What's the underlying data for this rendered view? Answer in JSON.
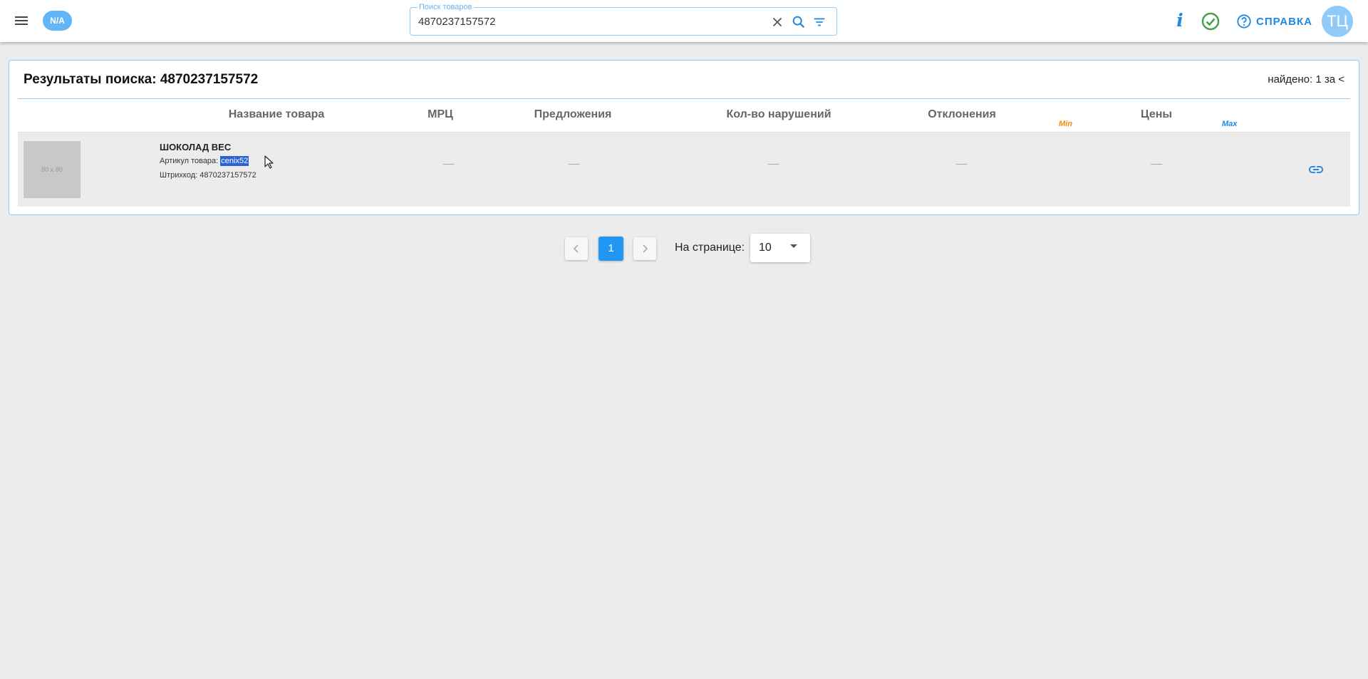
{
  "topbar": {
    "region_badge": "N/A",
    "search": {
      "label": "Поиск товаров",
      "value": "4870237157572"
    },
    "info_label": "i",
    "help_label": "СПРАВКА",
    "avatar_initials": "ТЦ"
  },
  "results": {
    "title": "Результаты поиска: 4870237157572",
    "found": "найдено: 1 за <",
    "columns": {
      "name": "Название товара",
      "mrp": "МРЦ",
      "offers": "Предложения",
      "violations": "Кол-во нарушений",
      "deviations": "Отклонения",
      "prices": "Цены",
      "min": "Min",
      "max": "Max"
    },
    "rows": [
      {
        "thumb": "80 x 80",
        "name": "ШОКОЛАД ВЕС",
        "sku_label": "Артикул товара:",
        "sku": "cenix52",
        "barcode_label": "Штрихкод:",
        "barcode": "4870237157572"
      }
    ]
  },
  "pagination": {
    "current_page": "1",
    "per_page_label": "На странице:",
    "per_page_value": "10"
  },
  "colors": {
    "accent": "#2196f3",
    "min": "#f08c00",
    "max": "#1e88e5",
    "ok": "#43a047"
  }
}
